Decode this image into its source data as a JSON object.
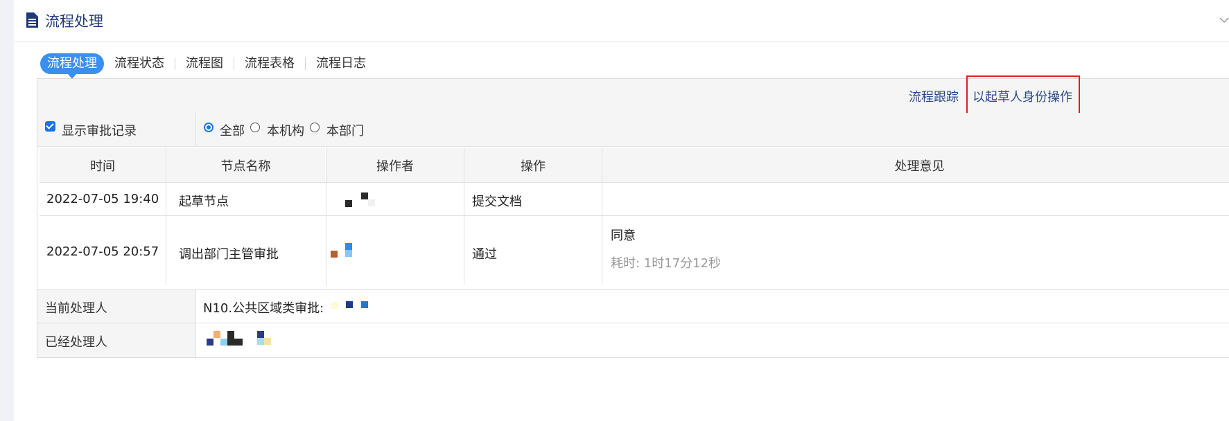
{
  "header": {
    "title": "流程处理"
  },
  "tabs": [
    {
      "label": "流程处理",
      "active": true
    },
    {
      "label": "流程状态",
      "active": false
    },
    {
      "label": "流程图",
      "active": false
    },
    {
      "label": "流程表格",
      "active": false
    },
    {
      "label": "流程日志",
      "active": false
    }
  ],
  "toolbar": {
    "trace_link": "流程跟踪",
    "drafter_link": "以起草人身份操作"
  },
  "filter": {
    "show_records_label": "显示审批记录",
    "show_records_checked": true,
    "scope_options": [
      "全部",
      "本机构",
      "本部门"
    ],
    "scope_selected": "全部"
  },
  "table": {
    "headers": [
      "时间",
      "节点名称",
      "操作者",
      "操作",
      "处理意见"
    ],
    "rows": [
      {
        "time": "2022-07-05 19:40",
        "node": "起草节点",
        "action": "提交文档",
        "opinion": "",
        "duration": ""
      },
      {
        "time": "2022-07-05 20:57",
        "node": "调出部门主管审批",
        "action": "通过",
        "opinion": "同意",
        "duration": "耗时: 1时17分12秒"
      }
    ]
  },
  "current_handler": {
    "label": "当前处理人",
    "value": "N10.公共区域类审批:"
  },
  "past_handler": {
    "label": "已经处理人"
  },
  "colors": {
    "accent": "#3b8ff0",
    "title": "#1f3a7a",
    "link": "#2b4a8b",
    "highlight_box": "#e02020"
  }
}
